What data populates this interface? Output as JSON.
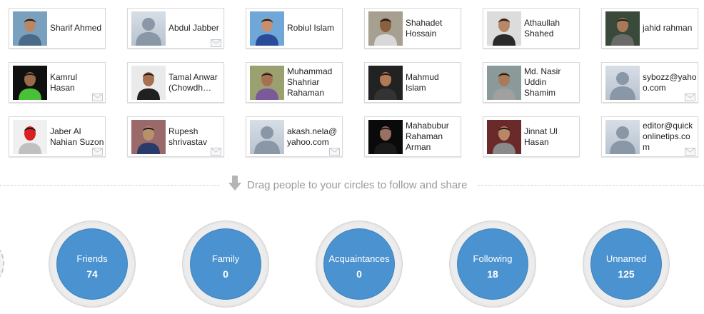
{
  "people": [
    {
      "name": "Sharif Ahmed",
      "avatar": "photo",
      "bg": "#7aa0c0",
      "skin": "#b88866",
      "shirt": "#4a6a8a",
      "mail": false
    },
    {
      "name": "Abdul Jabber",
      "avatar": "default",
      "mail": true
    },
    {
      "name": "Robiul Islam",
      "avatar": "photo",
      "bg": "#6fa8d8",
      "skin": "#c49070",
      "shirt": "#2a4a9a",
      "mail": false
    },
    {
      "name": "Shahadet Hossain",
      "avatar": "photo",
      "bg": "#a7a090",
      "skin": "#8a6040",
      "shirt": "#d8d8d8",
      "mail": false
    },
    {
      "name": "Athaullah Shahed",
      "avatar": "photo",
      "bg": "#dcdcdc",
      "skin": "#b88866",
      "shirt": "#2a2a2a",
      "mail": false
    },
    {
      "name": "jahid rahman",
      "avatar": "photo",
      "bg": "#3a4a3a",
      "skin": "#a87a5a",
      "shirt": "#6a6a6a",
      "mail": false
    },
    {
      "name": "Kamrul Hasan",
      "avatar": "photo",
      "bg": "#101010",
      "skin": "#9a6a4a",
      "shirt": "#48c038",
      "mail": true
    },
    {
      "name": "Tamal Anwar (Chowdh…",
      "avatar": "photo",
      "bg": "#eaeaea",
      "skin": "#a87050",
      "shirt": "#202020",
      "mail": false
    },
    {
      "name": "Muhammad Shahriar Rahaman",
      "avatar": "photo",
      "bg": "#9aa070",
      "skin": "#a87050",
      "shirt": "#7a5a9a",
      "mail": false
    },
    {
      "name": "Mahmud Islam",
      "avatar": "photo",
      "bg": "#222222",
      "skin": "#b07a55",
      "shirt": "#333333",
      "mail": false
    },
    {
      "name": "Md. Nasir Uddin Shamim",
      "avatar": "photo",
      "bg": "#8a9a9a",
      "skin": "#a87a5a",
      "shirt": "#a0a0a0",
      "mail": false
    },
    {
      "name": "sybozz@yahoo.com",
      "avatar": "default",
      "mail": true
    },
    {
      "name": "Jaber Al Nahian Suzon",
      "avatar": "photo",
      "bg": "#f0f0f0",
      "skin": "#d82020",
      "shirt": "#c0c0c0",
      "mail": true
    },
    {
      "name": "Rupesh shrivastav",
      "avatar": "photo",
      "bg": "#9a6a6a",
      "skin": "#b8906a",
      "shirt": "#2a3a6a",
      "mail": true
    },
    {
      "name": "akash.nela@yahoo.com",
      "avatar": "default",
      "mail": true
    },
    {
      "name": "Mahabubur Rahaman Arman",
      "avatar": "photo",
      "bg": "#0a0a0a",
      "skin": "#9a7060",
      "shirt": "#1a1a1a",
      "mail": false
    },
    {
      "name": "Jinnat Ul Hasan",
      "avatar": "photo",
      "bg": "#6a2a2a",
      "skin": "#b88866",
      "shirt": "#8a8a8a",
      "mail": false
    },
    {
      "name": "editor@quickonlinetips.com",
      "avatar": "default",
      "mail": true
    }
  ],
  "instruction": "Drag people to your circles to follow and share",
  "circles": [
    {
      "label": "Friends",
      "count": "74"
    },
    {
      "label": "Family",
      "count": "0"
    },
    {
      "label": "Acquaintances",
      "count": "0"
    },
    {
      "label": "Following",
      "count": "18"
    },
    {
      "label": "Unnamed",
      "count": "125"
    }
  ],
  "colors": {
    "circle_fill": "#4a92d0",
    "card_border": "#d9d9d9",
    "hint_text": "#9a9a9a"
  }
}
